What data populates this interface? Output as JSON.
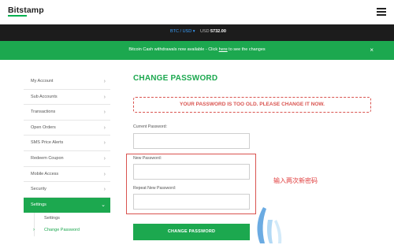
{
  "header": {
    "logo": "Bitstamp",
    "menu_icon": "hamburger-menu-icon"
  },
  "ticker": {
    "pair": "BTC / USD ▾",
    "currency": "USD",
    "price": "5732.00"
  },
  "announcement": {
    "text_before": "Bitcoin Cash withdrawals now available - Click ",
    "link": "here",
    "text_after": " to see the changes",
    "close": "×"
  },
  "sidebar": {
    "items": [
      {
        "label": "My Account"
      },
      {
        "label": "Sub Accounts"
      },
      {
        "label": "Transactions"
      },
      {
        "label": "Open Orders"
      },
      {
        "label": "SMS Price Alerts"
      },
      {
        "label": "Redeem Coupon"
      },
      {
        "label": "Mobile Access"
      },
      {
        "label": "Security"
      },
      {
        "label": "Settings"
      }
    ],
    "sub_items": [
      {
        "label": "Settings"
      },
      {
        "label": "Change Password"
      }
    ]
  },
  "main": {
    "title": "CHANGE PASSWORD",
    "warning": "YOUR PASSWORD IS TOO OLD. PLEASE CHANGE IT NOW.",
    "current_password_label": "Current Password:",
    "new_password_label": "New Password:",
    "repeat_password_label": "Repeat New Password:",
    "submit": "CHANGE PASSWORD"
  },
  "annotation": {
    "text": "输入两次新密码"
  },
  "colors": {
    "accent": "#1ca84f",
    "warning": "#d9534f",
    "ticker_bg": "#1c1c1c",
    "ticker_pair": "#3aa0ff"
  }
}
